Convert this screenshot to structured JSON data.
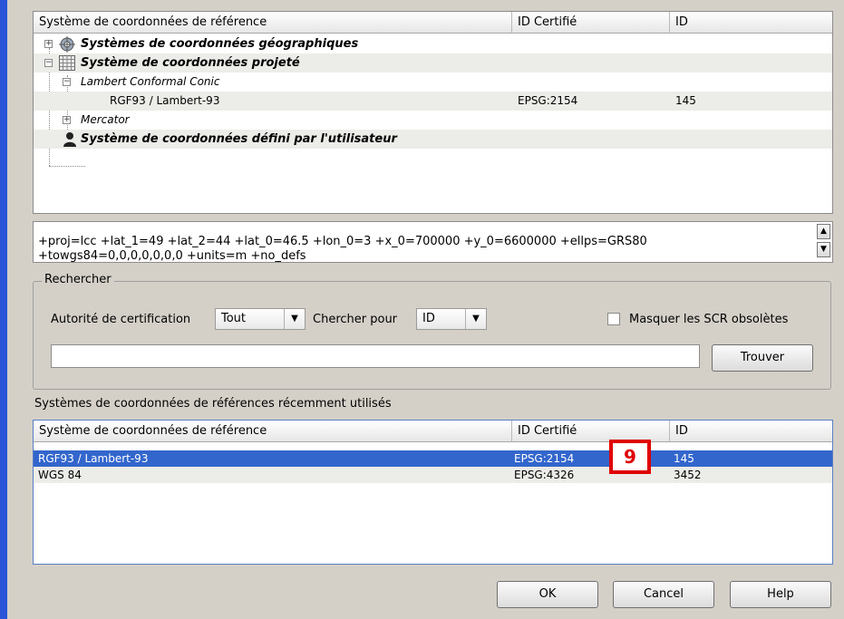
{
  "crs_tree": {
    "columns": [
      "Système de coordonnées de référence",
      "ID Certifié",
      "ID"
    ],
    "rows": [
      {
        "label": "Systèmes de coordonnées géographiques",
        "icon": "globe-icon",
        "auth": "",
        "id": ""
      },
      {
        "label": "Système de coordonnées projeté",
        "icon": "grid-icon",
        "auth": "",
        "id": ""
      },
      {
        "label": "Lambert Conformal Conic",
        "auth": "",
        "id": ""
      },
      {
        "label": "RGF93 / Lambert-93",
        "auth": "EPSG:2154",
        "id": "145"
      },
      {
        "label": "Mercator",
        "auth": "",
        "id": ""
      },
      {
        "label": "Système de coordonnées défini par l'utilisateur",
        "icon": "user-icon",
        "auth": "",
        "id": ""
      }
    ]
  },
  "proj_string": {
    "line1": "+proj=lcc +lat_1=49 +lat_2=44 +lat_0=46.5 +lon_0=3 +x_0=700000 +y_0=6600000 +ellps=GRS80",
    "line2": "+towgs84=0,0,0,0,0,0,0 +units=m +no_defs"
  },
  "search": {
    "group_title": "Rechercher",
    "authority_label": "Autorité de certification",
    "authority_value": "Tout",
    "search_for_label": "Chercher pour",
    "search_for_value": "ID",
    "hide_deprecated_label": "Masquer les SCR obsolètes",
    "hide_deprecated_checked": false,
    "input_value": "",
    "find_button": "Trouver"
  },
  "recent": {
    "title": "Systèmes de coordonnées de références récemment utilisés",
    "columns": [
      "Système de coordonnées de référence",
      "ID Certifié",
      "ID"
    ],
    "rows": [
      {
        "label": "RGF93 / Lambert-93",
        "auth": "EPSG:2154",
        "id": "145",
        "selected": true
      },
      {
        "label": "WGS 84",
        "auth": "EPSG:4326",
        "id": "3452",
        "selected": false
      }
    ]
  },
  "buttons": {
    "ok": "OK",
    "cancel": "Cancel",
    "help": "Help"
  },
  "annotation_badge": "9",
  "colors": {
    "selection": "#3366cc",
    "badge": "#e00000",
    "window_bg": "#d4d0c8"
  }
}
